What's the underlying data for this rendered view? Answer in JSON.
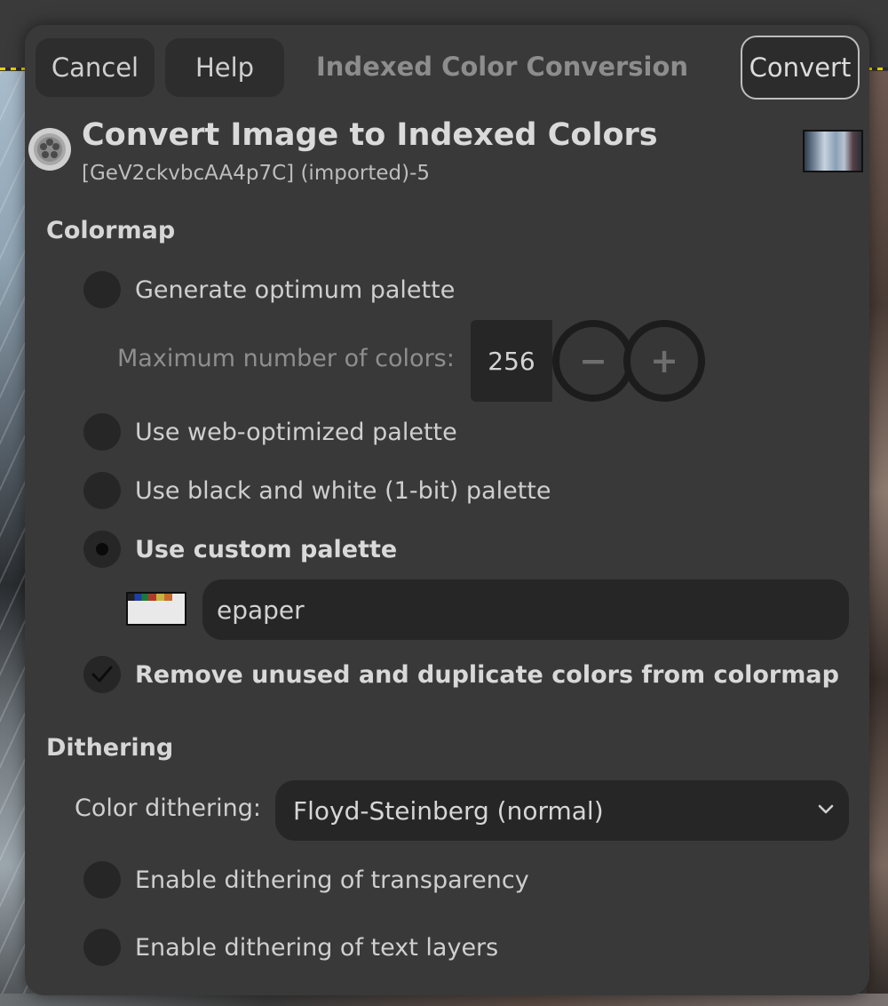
{
  "header": {
    "cancel_label": "Cancel",
    "help_label": "Help",
    "title": "Indexed Color Conversion",
    "convert_label": "Convert"
  },
  "heading": {
    "title": "Convert Image to Indexed Colors",
    "subtitle": "[GeV2ckvbcAA4p7C] (imported)-5"
  },
  "colormap": {
    "section_label": "Colormap",
    "options": [
      {
        "label": "Generate optimum palette",
        "selected": false
      },
      {
        "label": "Use web-optimized palette",
        "selected": false
      },
      {
        "label": "Use black and white (1-bit) palette",
        "selected": false
      },
      {
        "label": "Use custom palette",
        "selected": true
      }
    ],
    "max_colors_label": "Maximum number of colors:",
    "max_colors_value": "256",
    "minus_symbol": "−",
    "plus_symbol": "+",
    "custom_palette_name": "epaper",
    "remove_unused_label": "Remove unused and duplicate colors from colormap",
    "remove_unused_checked": true
  },
  "dithering": {
    "section_label": "Dithering",
    "color_dithering_label": "Color dithering:",
    "color_dithering_value": "Floyd-Steinberg (normal)",
    "options": [
      {
        "label": "Enable dithering of transparency",
        "checked": false
      },
      {
        "label": "Enable dithering of text layers",
        "checked": false
      }
    ]
  },
  "colors": {
    "dialog_bg": "#393939",
    "field_bg": "#262626",
    "text": "#cfcfcf",
    "muted_text": "#8e8e8e",
    "accent_border": "#bdbdbd"
  }
}
